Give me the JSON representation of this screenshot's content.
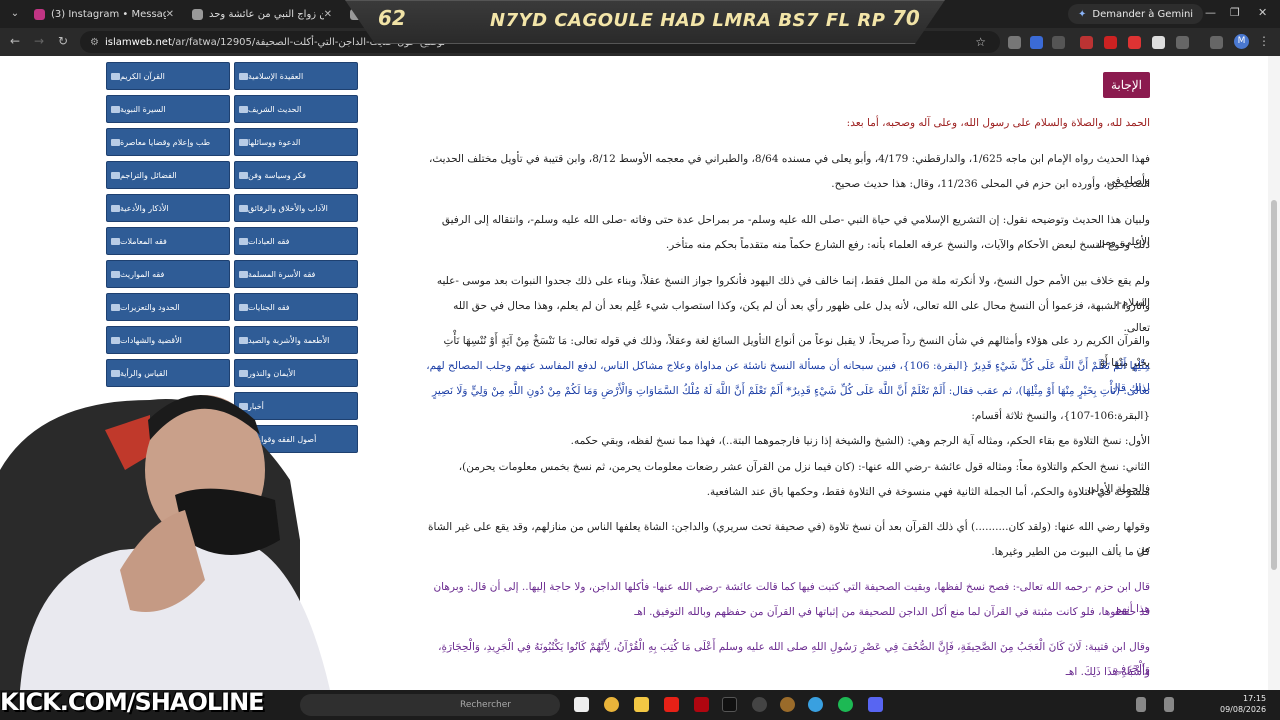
{
  "tabs": [
    {
      "label": "(3) Instagram • Messages",
      "color": "#c13584"
    },
    {
      "label": "دفاع عن زواج النبي من عائشة وحد...",
      "color": "#999999"
    },
    {
      "label": "",
      "color": "#999999"
    }
  ],
  "gemini": {
    "label": "Demander à Gemini"
  },
  "address": {
    "url_domain": "islamweb.net",
    "url_path": "/ar/fatwa/12905/توضيح-حول-حديث-الداجن-التي-أكلت-الصحيفة"
  },
  "banner": {
    "left_score": "62",
    "title": "N7YD CAGOULE HAD LMRA BS7 FL RP",
    "right_score": "70"
  },
  "sidebar": {
    "left_column": [
      "القرآن الكريم",
      "السيرة النبوية",
      "طب وإعلام وقضايا معاصرة",
      "الفضائل والتراجم",
      "الأذكار والأدعية",
      "فقه المعاملات",
      "فقه المواريث",
      "الحدود والتعزيرات",
      "الأقضية والشهادات",
      "القياس والرأية",
      "",
      "أصول الفقه وقواعده"
    ],
    "right_column": [
      "العقيدة الإسلامية",
      "الحديث الشريف",
      "الدعوة ووسائلها",
      "فكر وسياسة وفن",
      "الآداب والأخلاق والرقائق",
      "فقه العبادات",
      "فقه الأسرة المسلمة",
      "فقه الجنايات",
      "الأطعمة والأشربة والصيد",
      "الأيمان والنذور",
      "أخبار",
      ""
    ]
  },
  "article": {
    "badge": "الإجابة",
    "opening": "الحمد لله، والصلاة والسلام على رسول الله، وعلى آله وصحبه، أما بعد:",
    "p1_a": "فهذا الحديث رواه الإمام ابن ماجه 1/625، والدارقطني: 4/179، وأبو يعلى في مسنده 8/64، والطبراني في معجمه الأوسط 8/12، وابن قتيبة في تأويل مختلف الحديث، وأصله في",
    "p1_b": "الصحيحين، وأورده ابن حزم في المحلى 11/236، وقال: هذا حديث صحيح.",
    "p2_a": "ولبيان هذا الحديث وتوضيحه نقول: إن التشريع الإسلامي في حياة النبي -صلى الله عليه وسلم- مر بمراحل عدة حتى وفاته -صلى الله عليه وسلم-، وانتقاله إلى الرفيق الأعلى، ومن",
    "p2_b": "ذلك وقوع النسخ لبعض الأحكام والآيات، والنسخ عرفه العلماء بأنه: رفع الشارع حكماً منه متقدماً بحكم منه متأخر.",
    "p3_a": "ولم يقع خلاف بين الأمم حول النسخ، ولا أنكرته ملة من الملل فقط، إنما خالف في ذلك اليهود فأنكروا جواز النسخ عقلاً، وبناء على ذلك جحدوا النبوات بعد موسى -عليه السلام-،",
    "p3_b": "وأثاروا الشبهة، فزعموا أن النسخ محال على الله تعالى، لأنه يدل على ظهور رأي بعد أن لم يكن، وكذا استصواب شيء عُلِم بعد أن لم يعلم، وهذا محال في حق الله تعالى.",
    "p4_a": "والقرآن الكريم رد على هؤلاء وأمثالهم في شأن النسخ رداً صريحاً، لا يقبل نوعاً من أنواع التأويل السائغ لغة وعقلاً، وذلك في قوله تعالى: مَا نَنْسَخْ مِنْ آيَةٍ أَوْ نُنْسِهَا نَأْتِ بِخَيْرٍ مِنْهَا أَوْ",
    "p4_b": "مِثْلِهَا أَلَمْ تَعْلَمْ أَنَّ اللَّهَ عَلَى كُلِّ شَيْءٍ قَدِيرٌ {البقرة: 106}، فبين سبحانه أن مسألة النسخ ناشئة عن مداواة وعلاج مشاكل الناس، لدفع المفاسد عنهم وجلب المصالح لهم، لذلك قال",
    "p4_c": "تعالى: (نَأْتِ بِخَيْرٍ مِنْهَا أَوْ مِثْلِهَا)، ثم عقب فقال: أَلَمْ تَعْلَمْ أَنَّ اللَّهَ عَلَى كُلِّ شَيْءٍ قَدِيرٌ* أَلَمْ تَعْلَمْ أَنَّ اللَّهَ لَهُ مُلْكُ السَّمَاوَاتِ وَالْأَرْضِ وَمَا لَكُمْ مِنْ دُونِ اللَّهِ مِنْ وَلِيٍّ وَلَا نَصِيرٍ",
    "p4_d": "{البقرة:106-107}، والنسخ ثلاثة أقسام:",
    "p5": "الأول: نسخ التلاوة مع بقاء الحكم، ومثاله آية الرجم وهي: (الشيخ والشيخة إذا زنيا فارجموهما البتة..)، فهذا مما نسخ لفظه، وبقي حكمه.",
    "p6_a": "الثاني: نسخ الحكم والتلاوة معاً: ومثاله قول عائشة -رضي الله عنها-: (كان فيما نزل من القرآن عشر رضعات معلومات يحرمن، ثم نسخ بخمس معلومات يحرمن)، فالجملة الأولى",
    "p6_b": "منسوخة في التلاوة والحكم، أما الجملة الثانية فهي منسوخة في التلاوة فقط، وحكمها باق عند الشافعية.",
    "p7_a": "وقولها رضي الله عنها: (ولقد كان..........) أي ذلك القرآن بعد أن نسخ تلاوة (في صحيفة تحت سريري) والداجن: الشاة يعلفها الناس من منازلهم، وقد يقع على غير الشاة من",
    "p7_b": "كل ما يألف البيوت من الطير وغيرها.",
    "p8_a": "قال ابن حزم -رحمه الله تعالى-: فصح نسخ لفظها، وبقيت الصحيفة التي كتبت فيها كما قالت عائشة -رضي الله عنها- فأكلها الداجن، ولا حاجة إليها.. إلى أن قال: وبرهان هذا أنهم",
    "p8_b": "قد حفظوها، فلو كانت مثبتة في القرآن لما منع أكل الداجن للصحيفة من إثباتها في القرآن من حفظهم وبالله التوفيق. اهـ",
    "p9_a": "وقال ابن قتيبة: لَانَ كَانَ الْعَجَبُ مِنَ الصَّحِيفَةِ، فَإِنَّ الصُّحُفَ فِي عَصْرِ رَسُولِ اللهِ صلى الله عليه وسلم أَعْلَى مَا كُتِبَ بِهِ الْقُرْآنُ، لِأَنَّهُمْ كَانُوا يَكْتُبُونَهُ فِي الْجَرِيدِ، وَالْحِجَارَةِ، وَالْخَزَفِ،",
    "p9_b": "وَأَشْبَاهِ هَذَا ذَلِكَ. اهـ"
  },
  "taskbar": {
    "search_placeholder": "Rechercher",
    "time": "17:15",
    "date": "09/08/2026"
  },
  "overlay": {
    "kick_prefix": "K",
    "kick_rest": "KICK.COM/SHAOLINE"
  },
  "colors": {
    "sidebar_button": "#2f5c96",
    "badge": "#8b1b4f",
    "kick_green": "#53fc18"
  }
}
